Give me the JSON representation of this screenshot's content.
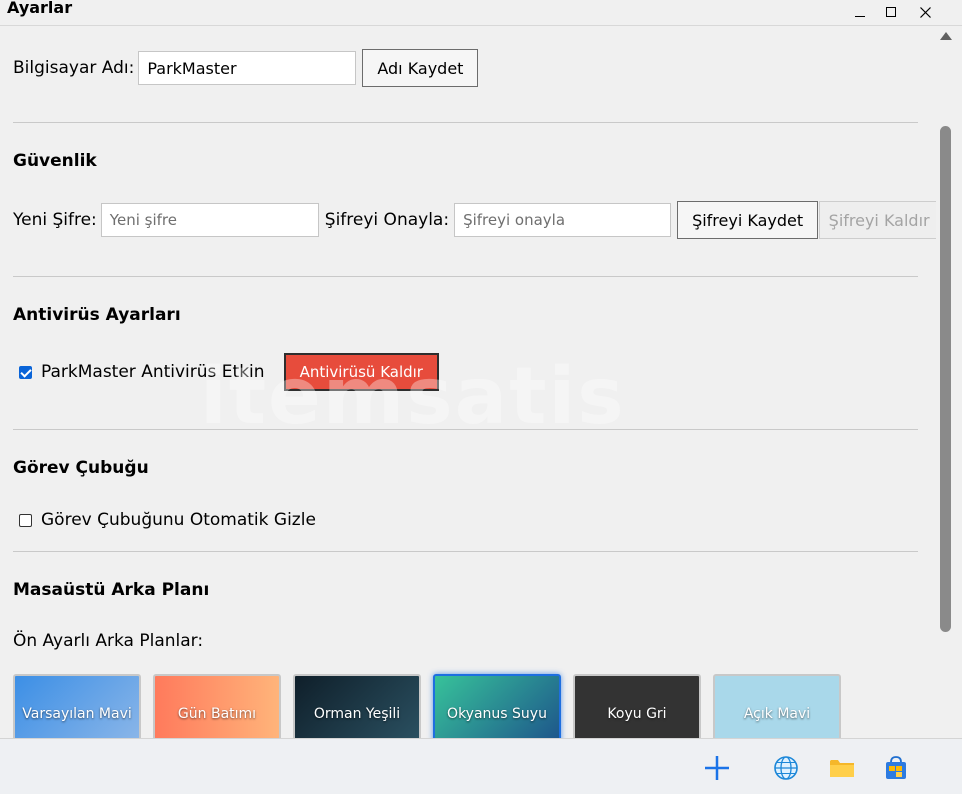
{
  "window": {
    "title": "Ayarlar"
  },
  "computer": {
    "label": "Bilgisayar Adı:",
    "value": "ParkMaster",
    "save_button": "Adı Kaydet"
  },
  "security": {
    "title": "Güvenlik",
    "new_password_label": "Yeni Şifre:",
    "new_password_placeholder": "Yeni şifre",
    "confirm_label": "Şifreyi Onayla:",
    "confirm_placeholder": "Şifreyi onayla",
    "save_button": "Şifreyi Kaydet",
    "remove_button": "Şifreyi Kaldır"
  },
  "antivirus": {
    "title": "Antivirüs Ayarları",
    "enabled_label": "ParkMaster Antivirüs Etkin",
    "enabled": true,
    "remove_button": "Antivirüsü Kaldır"
  },
  "taskbar_settings": {
    "title": "Görev Çubuğu",
    "autohide_label": "Görev Çubuğunu Otomatik Gizle",
    "autohide": false
  },
  "background": {
    "title": "Masaüstü Arka Planı",
    "presets_label": "Ön Ayarlı Arka Planlar:",
    "presets": [
      {
        "label": "Varsayılan Mavi"
      },
      {
        "label": "Gün Batımı"
      },
      {
        "label": "Orman Yeşili"
      },
      {
        "label": "Okyanus Suyu",
        "selected": true
      },
      {
        "label": "Koyu Gri"
      },
      {
        "label": "Açık Mavi"
      }
    ]
  },
  "colors": {
    "danger": "#e74c3c",
    "accent": "#1e6fe0"
  },
  "taskbar_icons": [
    "start-icon",
    "browser-globe-icon",
    "folder-icon",
    "store-bag-icon"
  ],
  "watermark": "itemsatis"
}
